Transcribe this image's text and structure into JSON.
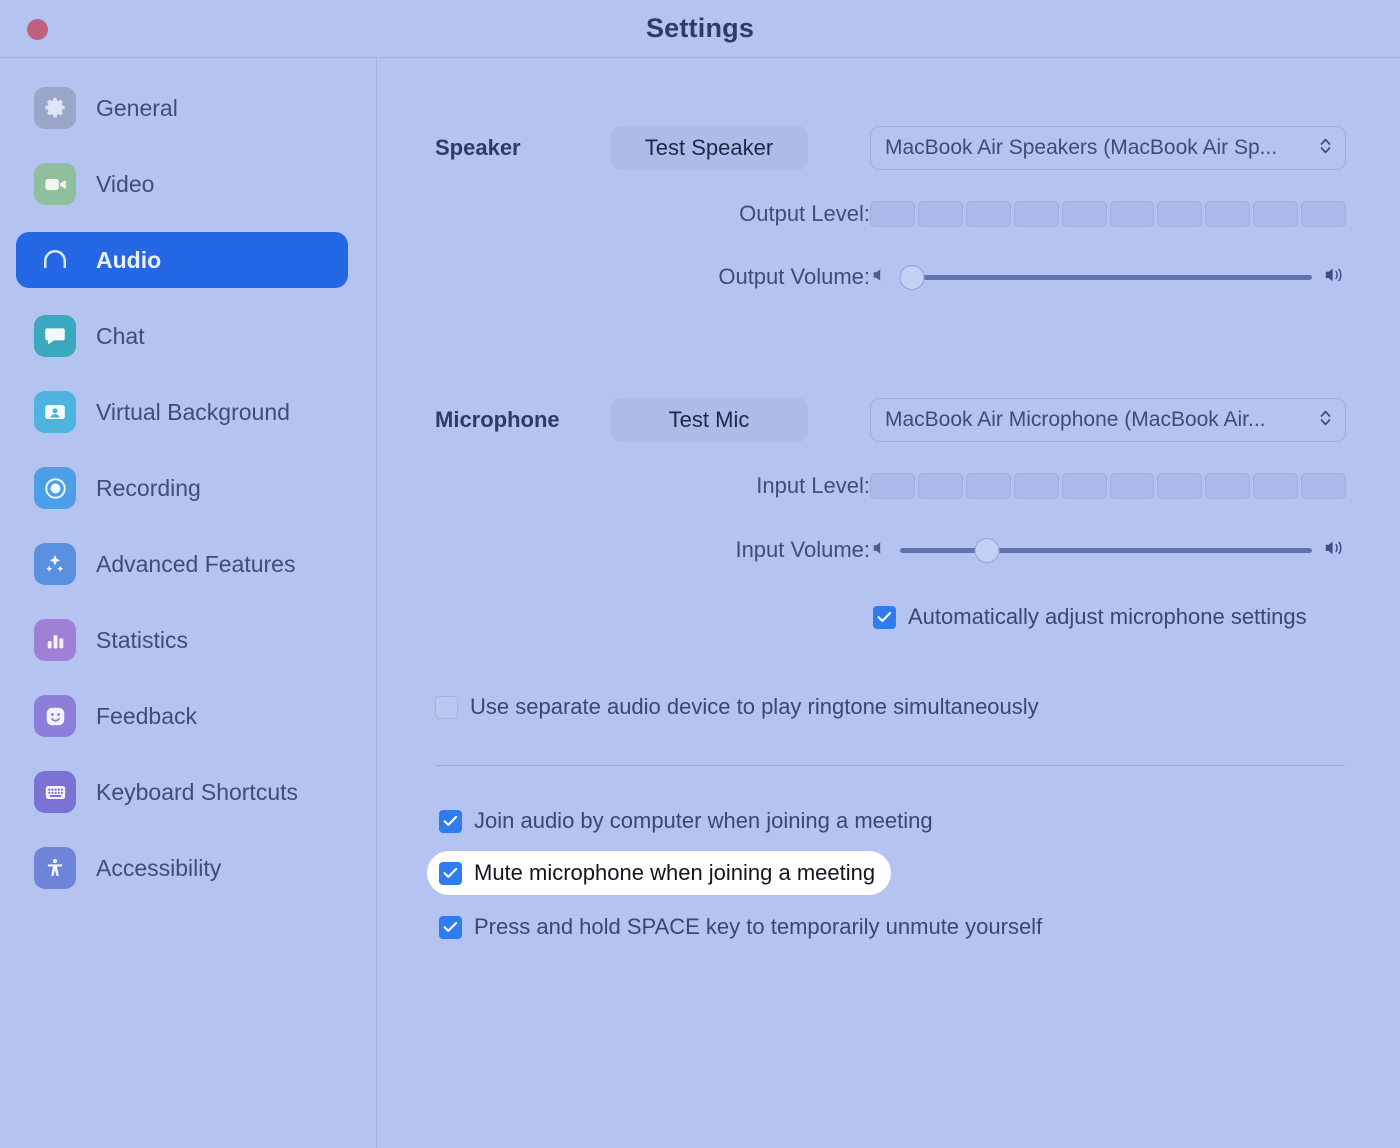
{
  "window": {
    "title": "Settings",
    "close_button": "close",
    "accent_color": "#2568e6",
    "background_color": "#b4c3ef"
  },
  "sidebar": {
    "items": [
      {
        "label": "General",
        "icon": "gear-icon",
        "icon_color": "#9aa6c8",
        "selected": false
      },
      {
        "label": "Video",
        "icon": "video-camera-icon",
        "icon_color": "#8fbf9c",
        "selected": false
      },
      {
        "label": "Audio",
        "icon": "headphones-icon",
        "icon_color": "#2568e6",
        "selected": true
      },
      {
        "label": "Chat",
        "icon": "chat-bubble-icon",
        "icon_color": "#3aa8bf",
        "selected": false
      },
      {
        "label": "Virtual Background",
        "icon": "person-card-icon",
        "icon_color": "#4cb4dd",
        "selected": false
      },
      {
        "label": "Recording",
        "icon": "record-circle-icon",
        "icon_color": "#4c9fe6",
        "selected": false
      },
      {
        "label": "Advanced Features",
        "icon": "sparkles-icon",
        "icon_color": "#5b8fe0",
        "selected": false
      },
      {
        "label": "Statistics",
        "icon": "bar-chart-icon",
        "icon_color": "#a080d4",
        "selected": false
      },
      {
        "label": "Feedback",
        "icon": "smiley-face-icon",
        "icon_color": "#8b7fdb",
        "selected": false
      },
      {
        "label": "Keyboard Shortcuts",
        "icon": "keyboard-icon",
        "icon_color": "#7b72d6",
        "selected": false
      },
      {
        "label": "Accessibility",
        "icon": "accessibility-icon",
        "icon_color": "#6d84d9",
        "selected": false
      }
    ]
  },
  "speaker": {
    "section_label": "Speaker",
    "test_button": "Test Speaker",
    "device": "MacBook Air Speakers (MacBook Air Sp...",
    "output_level_label": "Output Level:",
    "output_level_segments": 10,
    "output_level_active": 0,
    "output_volume_label": "Output Volume:",
    "output_volume_percent": 3
  },
  "microphone": {
    "section_label": "Microphone",
    "test_button": "Test Mic",
    "device": "MacBook Air Microphone (MacBook Air...",
    "input_level_label": "Input Level:",
    "input_level_segments": 10,
    "input_level_active": 0,
    "input_volume_label": "Input Volume:",
    "input_volume_percent": 21,
    "auto_adjust": {
      "label": "Automatically adjust microphone settings",
      "checked": true
    }
  },
  "options": {
    "separate_ringtone": {
      "label": "Use separate audio device to play ringtone simultaneously",
      "checked": false
    },
    "join_audio": {
      "label": "Join audio by computer when joining a meeting",
      "checked": true
    },
    "mute_on_join": {
      "label": "Mute microphone when joining a meeting",
      "checked": true,
      "highlighted": true
    },
    "push_to_talk": {
      "label": "Press and hold SPACE key to temporarily unmute yourself",
      "checked": true
    }
  }
}
